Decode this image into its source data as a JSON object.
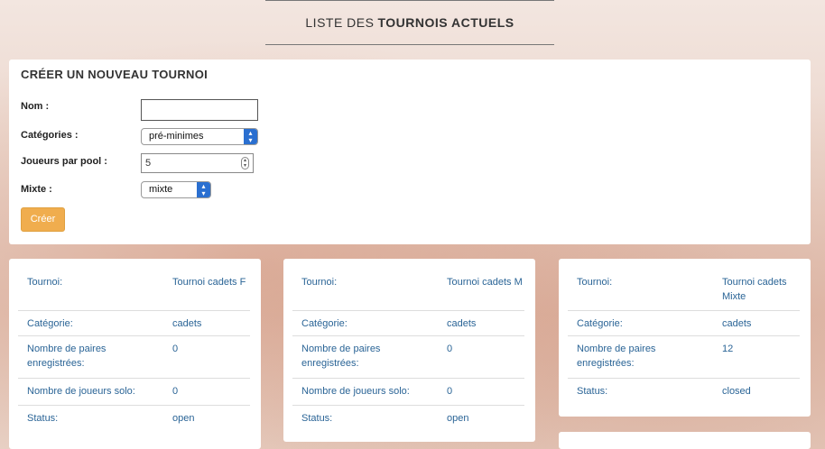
{
  "header": {
    "prefix": "LISTE DES",
    "bold": "TOURNOIS ACTUELS"
  },
  "create": {
    "title": "CRÉER UN NOUVEAU TOURNOI",
    "name_label": "Nom :",
    "name_value": "",
    "category_label": "Catégories :",
    "category_value": "pré-minimes",
    "players_label": "Joueurs par pool :",
    "players_value": "5",
    "mixed_label": "Mixte :",
    "mixed_value": "mixte",
    "submit_label": "Créer"
  },
  "tournaments": [
    {
      "rows": [
        {
          "label": "Tournoi:",
          "value": "Tournoi cadets F"
        },
        {
          "label": "Catégorie:",
          "value": "cadets"
        },
        {
          "label": "Nombre de paires enregistrées:",
          "value": "0"
        },
        {
          "label": "Nombre de joueurs solo:",
          "value": "0"
        },
        {
          "label": "Status:",
          "value": "open"
        }
      ]
    },
    {
      "rows": [
        {
          "label": "Tournoi:",
          "value": "Tournoi cadets M"
        },
        {
          "label": "Catégorie:",
          "value": "cadets"
        },
        {
          "label": "Nombre de paires enregistrées:",
          "value": "0"
        },
        {
          "label": "Nombre de joueurs solo:",
          "value": "0"
        },
        {
          "label": "Status:",
          "value": "open"
        }
      ]
    },
    {
      "rows": [
        {
          "label": "Tournoi:",
          "value": "Tournoi cadets Mixte"
        },
        {
          "label": "Catégorie:",
          "value": "cadets"
        },
        {
          "label": "Nombre de paires enregistrées:",
          "value": "12"
        },
        {
          "label": "Status:",
          "value": "closed"
        }
      ]
    }
  ],
  "icons": {
    "select_arrow": "chevron-updown-icon",
    "spinner": "spinner-updown-icon"
  }
}
